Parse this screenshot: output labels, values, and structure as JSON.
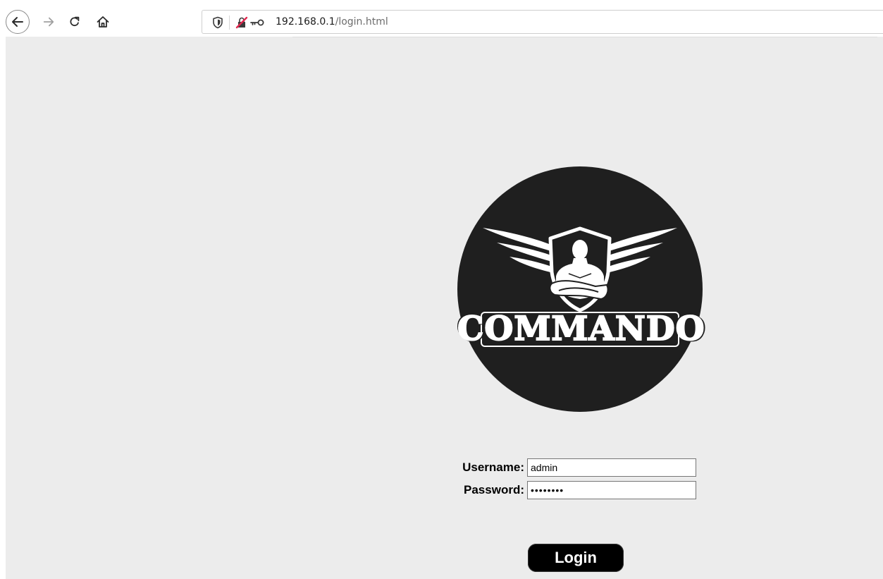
{
  "browser": {
    "url_host": "192.168.0.1",
    "url_path": "/login.html",
    "icons": {
      "back": "back-arrow-icon",
      "forward": "forward-arrow-icon",
      "reload": "reload-icon",
      "home": "home-icon",
      "shield": "tracking-protection-shield-icon",
      "insecure": "insecure-connection-icon",
      "key": "key-icon"
    }
  },
  "page": {
    "background": "#ececec",
    "logo": {
      "brand_text": "COMMANDO",
      "circle_color": "#1f1f1f"
    },
    "form": {
      "username_label": "Username:",
      "username_value": "admin",
      "password_label": "Password:",
      "password_masked": "••••••••",
      "login_button": "Login"
    }
  }
}
